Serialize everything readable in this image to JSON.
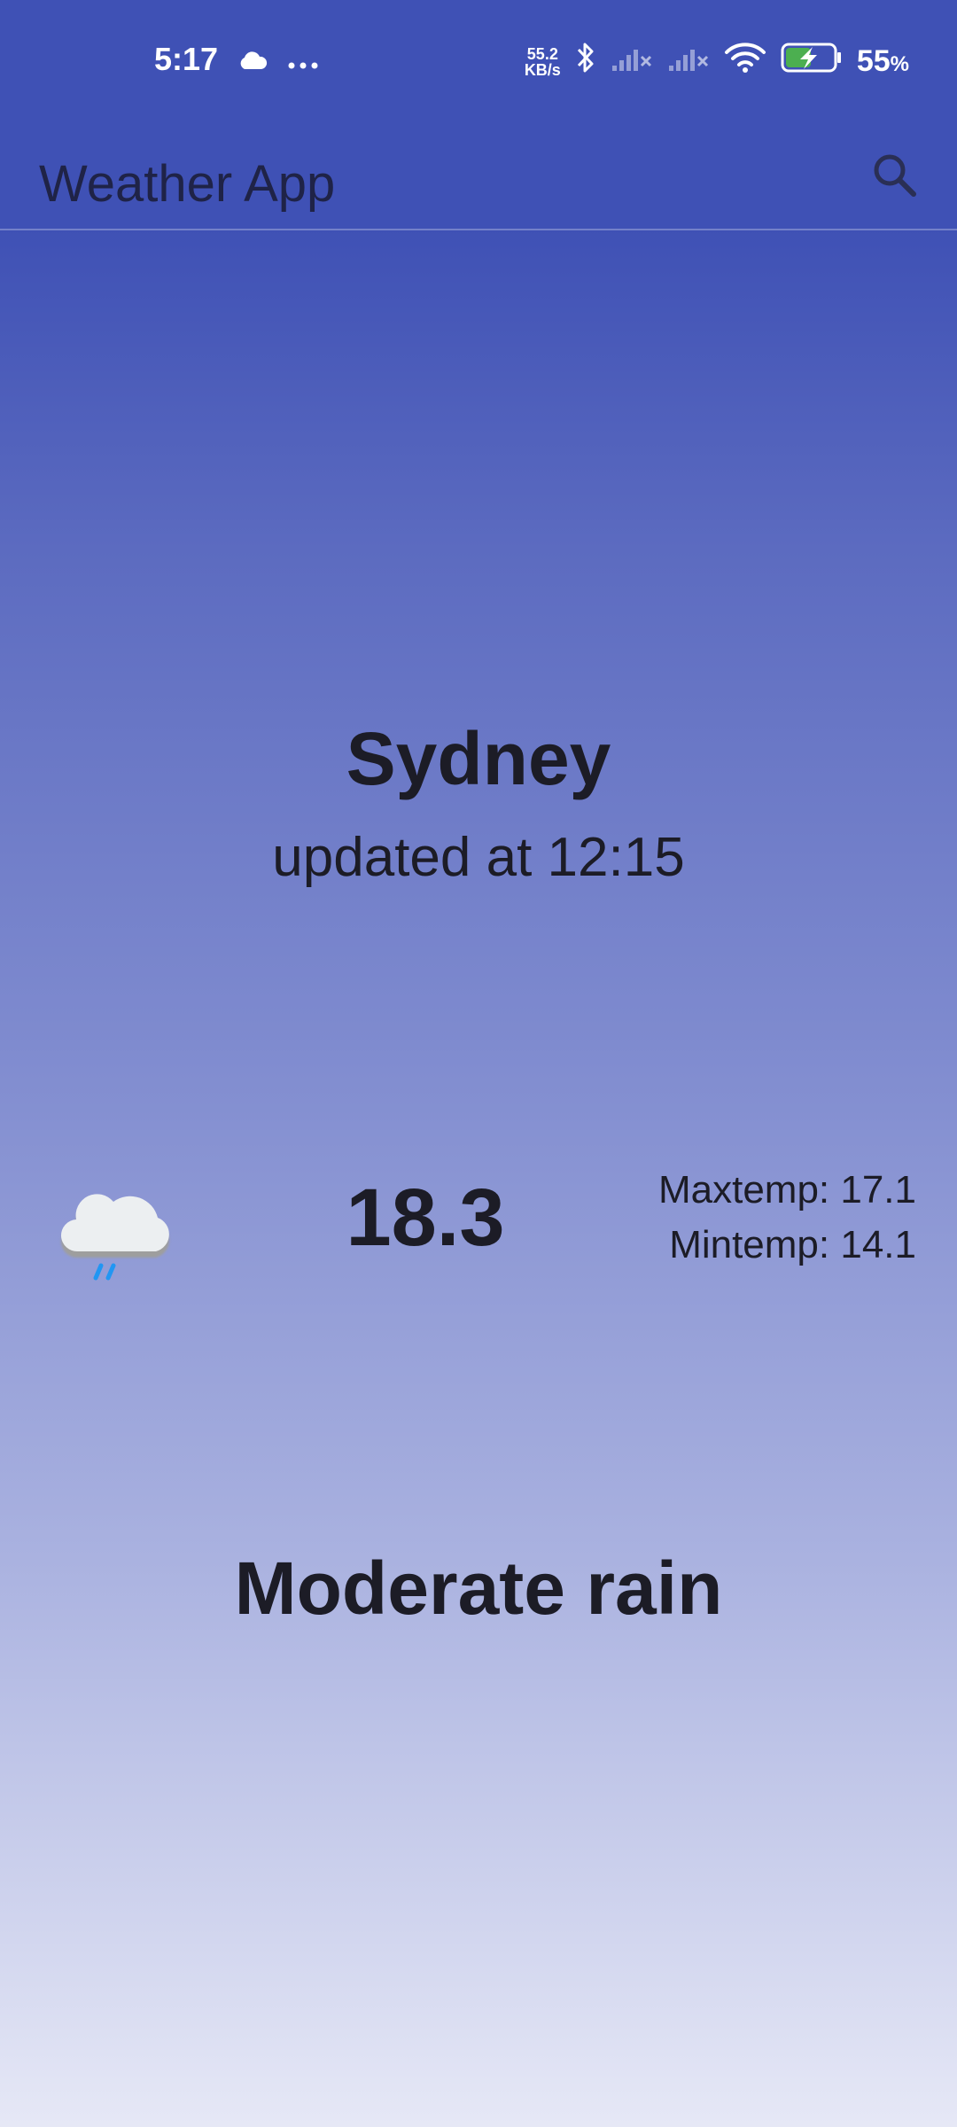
{
  "status_bar": {
    "time": "5:17",
    "net_speed_value": "55.2",
    "net_speed_unit": "KB/s",
    "battery_percent": "55",
    "battery_symbol": "%",
    "battery_level": 0.55
  },
  "app_bar": {
    "title": "Weather App",
    "search_icon": "search-icon"
  },
  "weather": {
    "city": "Sydney",
    "updated": "updated at 12:15",
    "temperature": "18.3",
    "max_temp": "Maxtemp: 17.1",
    "min_temp": "Mintemp: 14.1",
    "condition": "Moderate rain",
    "icon": "cloud-rain-icon"
  },
  "colors": {
    "app_bar": "#3f51b5",
    "gradient_bottom": "#e6e8f6",
    "rain_drops": "#2196f3"
  }
}
